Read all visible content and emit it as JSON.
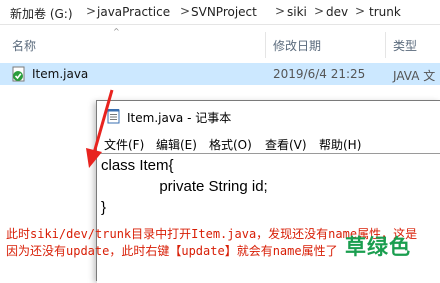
{
  "breadcrumb": {
    "segments": [
      "新加卷 (G:)",
      "javaPractice",
      "SVNProject",
      "siki",
      "dev",
      "trunk"
    ],
    "separator": ">"
  },
  "columns": {
    "name": "名称",
    "date": "修改日期",
    "type": "类型"
  },
  "file": {
    "name": "Item.java",
    "date": "2019/6/4 21:25",
    "type": "JAVA 文"
  },
  "notepad": {
    "title": "Item.java - 记事本",
    "menu": [
      "文件(F)",
      "编辑(E)",
      "格式(O)",
      "查看(V)",
      "帮助(H)"
    ],
    "code": [
      "class Item{",
      "              private String id;",
      "}"
    ]
  },
  "annotation": "此时siki/dev/trunk目录中打开Item.java，发现还没有name属性，这是因为还没有update，此时右键【update】就会有name属性了",
  "watermark": "草绿色",
  "colors": {
    "annotation": "#d81e06",
    "selection": "#cce8ff",
    "arrow": "#e8231f",
    "watermark": "#1a9e4f"
  }
}
